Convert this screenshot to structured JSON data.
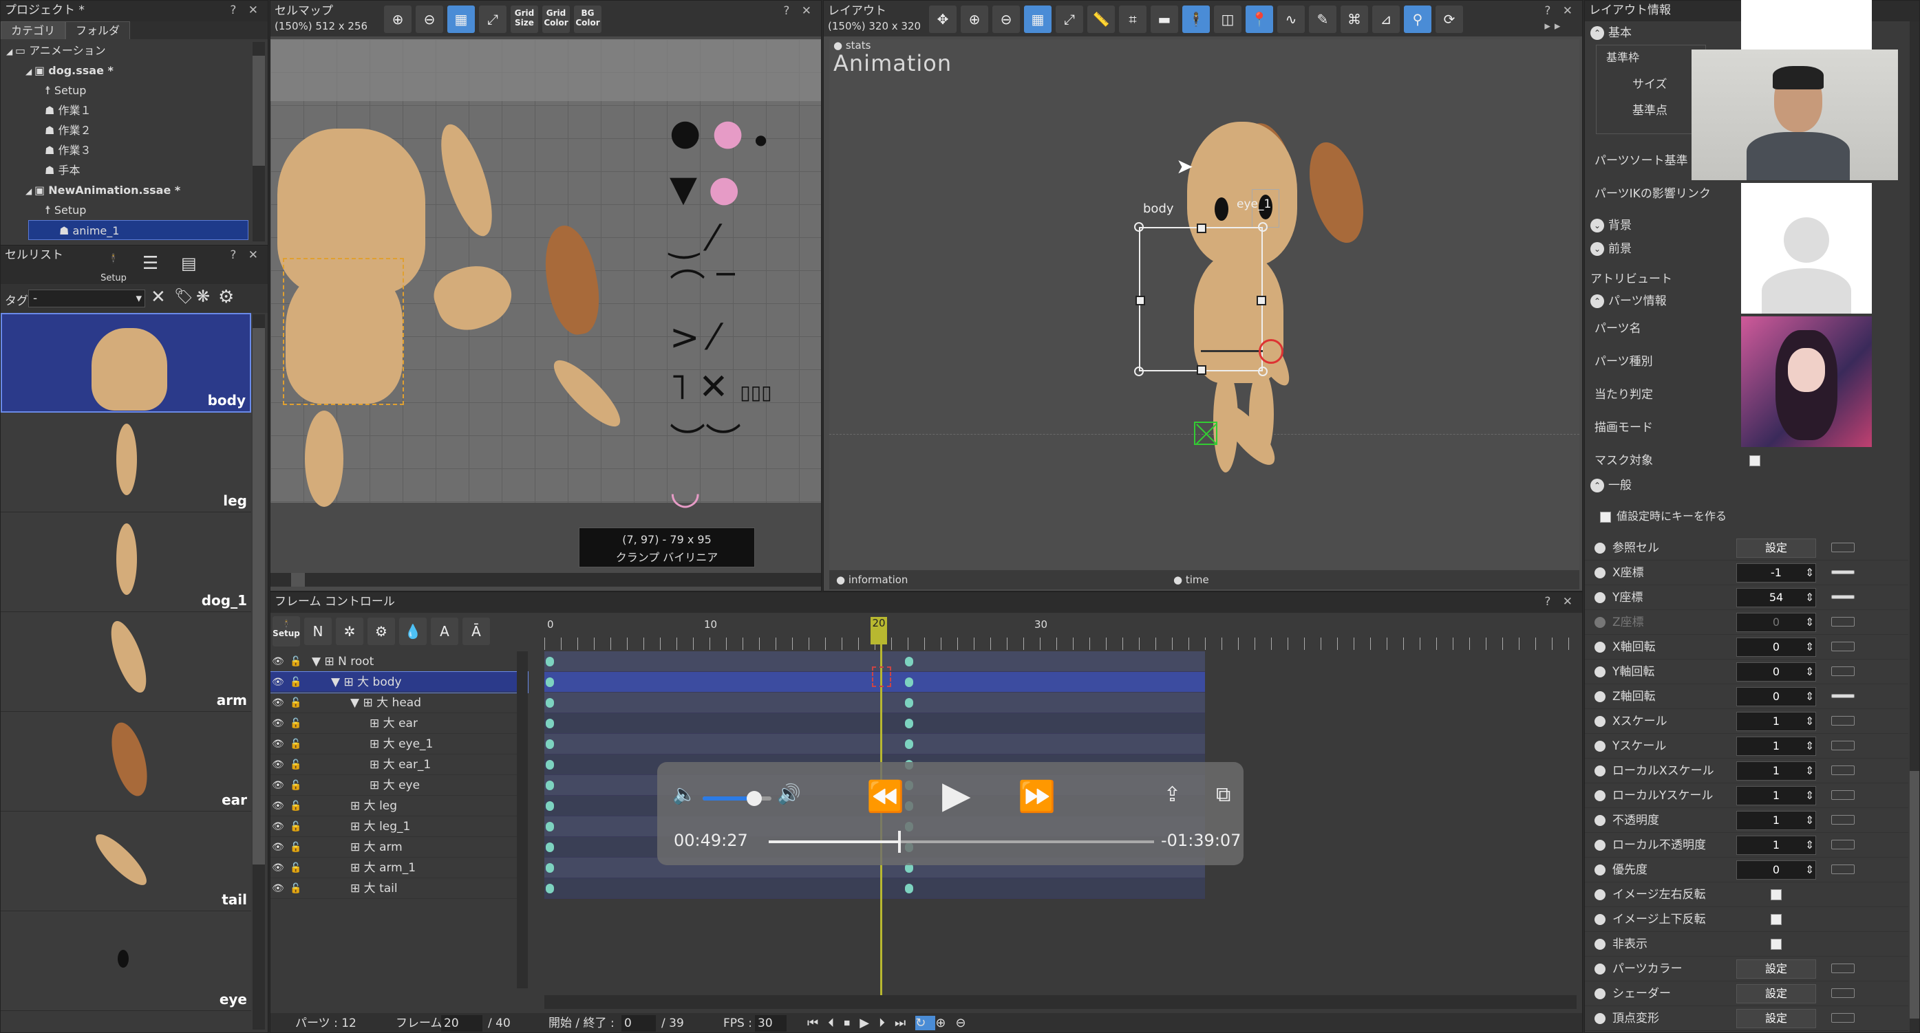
{
  "project": {
    "title": "プロジェクト *",
    "tabs": [
      "カテゴリ",
      "フォルダ"
    ],
    "tree": [
      {
        "label": "アニメーション",
        "level": 0,
        "icon": "folder"
      },
      {
        "label": "dog.ssae *",
        "level": 1,
        "icon": "file"
      },
      {
        "label": "Setup",
        "level": 2,
        "icon": "setup"
      },
      {
        "label": "作業１",
        "level": 2,
        "icon": "anim"
      },
      {
        "label": "作業２",
        "level": 2,
        "icon": "anim"
      },
      {
        "label": "作業３",
        "level": 2,
        "icon": "anim"
      },
      {
        "label": "手本",
        "level": 2,
        "icon": "anim"
      },
      {
        "label": "NewAnimation.ssae *",
        "level": 1,
        "icon": "file"
      },
      {
        "label": "Setup",
        "level": 2,
        "icon": "setup"
      },
      {
        "label": "anime_1",
        "level": 2,
        "icon": "anim",
        "selected": true
      }
    ]
  },
  "celllist": {
    "title": "セルリスト",
    "setup_label": "Setup",
    "tag_label": "タグ",
    "tag_value": "-",
    "cells": [
      {
        "label": "body",
        "selected": true
      },
      {
        "label": "leg"
      },
      {
        "label": "dog_1"
      },
      {
        "label": "arm"
      },
      {
        "label": "ear"
      },
      {
        "label": "tail"
      },
      {
        "label": "eye"
      }
    ]
  },
  "cellmap": {
    "title": "セルマップ",
    "subtitle": "(150%) 512 x 256",
    "tb_grid_size": "Grid Size",
    "tb_grid_color": "Grid Color",
    "tb_bg_color": "BG Color",
    "tooltip_line1": "(7, 97) - 79 x 95",
    "tooltip_line2": "クランプ バイリニア"
  },
  "layout": {
    "title": "レイアウト",
    "subtitle": "(150%) 320 x 320",
    "stats_label": "stats",
    "anim_label": "Animation",
    "body_tag": "body",
    "eye_tag": "eye_1",
    "info_label": "information",
    "time_label": "time"
  },
  "framecontrol": {
    "title": "フレーム コントロール",
    "setup_label": "Setup",
    "ruler": [
      "0",
      "10",
      "20",
      "30"
    ],
    "current_frame_label": "20",
    "parts": [
      {
        "label": "root",
        "indent": 0,
        "type": "N"
      },
      {
        "label": "body",
        "indent": 1,
        "type": "part",
        "selected": true
      },
      {
        "label": "head",
        "indent": 2,
        "type": "part"
      },
      {
        "label": "ear",
        "indent": 3,
        "type": "part"
      },
      {
        "label": "eye_1",
        "indent": 3,
        "type": "part"
      },
      {
        "label": "ear_1",
        "indent": 3,
        "type": "part"
      },
      {
        "label": "eye",
        "indent": 3,
        "type": "part"
      },
      {
        "label": "leg",
        "indent": 2,
        "type": "part"
      },
      {
        "label": "leg_1",
        "indent": 2,
        "type": "part"
      },
      {
        "label": "arm",
        "indent": 2,
        "type": "part"
      },
      {
        "label": "arm_1",
        "indent": 2,
        "type": "part"
      },
      {
        "label": "tail",
        "indent": 2,
        "type": "part"
      }
    ],
    "status": {
      "parts_label": "パーツ : 12",
      "frame_label": "フレーム :",
      "frame_value": "20",
      "frame_total": "/ 40",
      "range_label": "開始 / 終了 :",
      "range_start": "0",
      "range_end": "/ 39",
      "fps_label": "FPS :",
      "fps_value": "30"
    }
  },
  "player": {
    "elapsed": "00:49:27",
    "remaining": "-01:39:07",
    "progress": 0.34,
    "volume": 0.75
  },
  "props": {
    "title": "レイアウト情報",
    "basic": "基本",
    "base_frame": "基準枠",
    "size": "サイズ",
    "origin": "基準点",
    "sort_base": "パーツソート基準",
    "ik": "パーツIKの影響リンク",
    "bg": "背景",
    "fg": "前景",
    "attribute": "アトリビュート",
    "part_info": "パーツ情報",
    "part_name": "パーツ名",
    "part_type": "パーツ種別",
    "hit": "当たり判定",
    "draw_mode": "描画モード",
    "mask": "マスク対象",
    "general": "一般",
    "key_on_set": "値設定時にキーを作る",
    "rows": [
      {
        "label": "参照セル",
        "value": "設定",
        "kind": "btn"
      },
      {
        "label": "X座標",
        "value": "-1",
        "kind": "num",
        "bar": true
      },
      {
        "label": "Y座標",
        "value": "54",
        "kind": "num",
        "bar": true
      },
      {
        "label": "Z座標",
        "value": "0",
        "kind": "num",
        "disabled": true
      },
      {
        "label": "X軸回転",
        "value": "0",
        "kind": "num"
      },
      {
        "label": "Y軸回転",
        "value": "0",
        "kind": "num"
      },
      {
        "label": "Z軸回転",
        "value": "0",
        "kind": "num",
        "bar": true
      },
      {
        "label": "Xスケール",
        "value": "1",
        "kind": "num"
      },
      {
        "label": "Yスケール",
        "value": "1",
        "kind": "num"
      },
      {
        "label": "ローカルXスケール",
        "value": "1",
        "kind": "num"
      },
      {
        "label": "ローカルYスケール",
        "value": "1",
        "kind": "num"
      },
      {
        "label": "不透明度",
        "value": "1",
        "kind": "num"
      },
      {
        "label": "ローカル不透明度",
        "value": "1",
        "kind": "num"
      },
      {
        "label": "優先度",
        "value": "0",
        "kind": "num"
      },
      {
        "label": "イメージ左右反転",
        "value": "",
        "kind": "chk"
      },
      {
        "label": "イメージ上下反転",
        "value": "",
        "kind": "chk"
      },
      {
        "label": "非表示",
        "value": "",
        "kind": "chk"
      },
      {
        "label": "パーツカラー",
        "value": "設定",
        "kind": "btn"
      },
      {
        "label": "シェーダー",
        "value": "設定",
        "kind": "btn"
      },
      {
        "label": "頂点変形",
        "value": "設定",
        "kind": "btn"
      }
    ]
  }
}
